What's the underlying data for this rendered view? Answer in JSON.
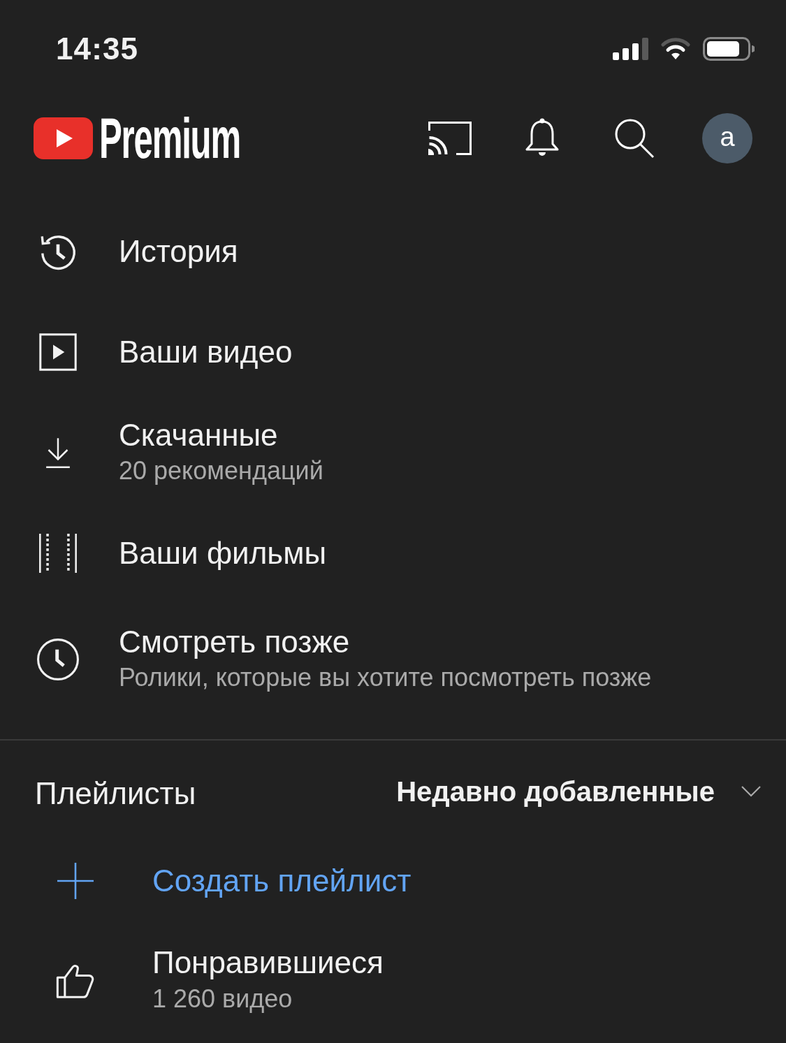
{
  "status_bar": {
    "time": "14:35"
  },
  "header": {
    "logo_text": "Premium",
    "avatar_letter": "a"
  },
  "library": [
    {
      "kind": "history",
      "title": "История"
    },
    {
      "kind": "your_videos",
      "title": "Ваши видео"
    },
    {
      "kind": "downloads",
      "title": "Скачанные",
      "subtitle": "20 рекомендаций"
    },
    {
      "kind": "movies",
      "title": "Ваши фильмы"
    },
    {
      "kind": "watch_later",
      "title": "Смотреть позже",
      "subtitle": "Ролики, которые вы хотите посмотреть позже"
    }
  ],
  "playlists": {
    "title": "Плейлисты",
    "sort": "Недавно добавленные",
    "items": [
      {
        "kind": "create",
        "title": "Создать плейлист"
      },
      {
        "kind": "liked",
        "title": "Понравившиеся",
        "subtitle": "1 260 видео"
      }
    ]
  }
}
